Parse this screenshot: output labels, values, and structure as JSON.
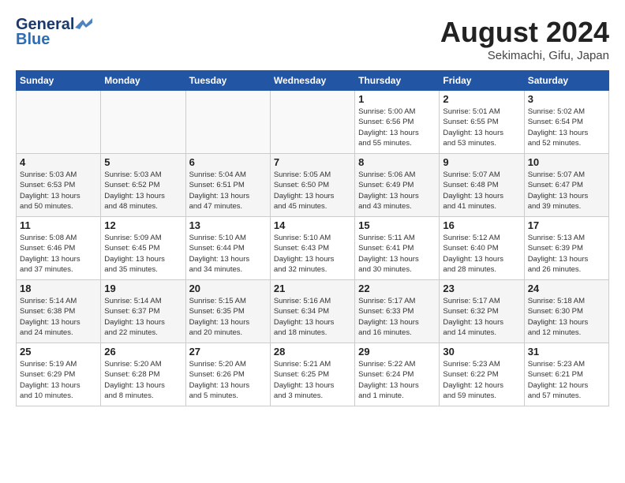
{
  "header": {
    "logo_general": "General",
    "logo_blue": "Blue",
    "month_title": "August 2024",
    "subtitle": "Sekimachi, Gifu, Japan"
  },
  "days_of_week": [
    "Sunday",
    "Monday",
    "Tuesday",
    "Wednesday",
    "Thursday",
    "Friday",
    "Saturday"
  ],
  "weeks": [
    [
      {
        "day": "",
        "text": ""
      },
      {
        "day": "",
        "text": ""
      },
      {
        "day": "",
        "text": ""
      },
      {
        "day": "",
        "text": ""
      },
      {
        "day": "1",
        "text": "Sunrise: 5:00 AM\nSunset: 6:56 PM\nDaylight: 13 hours\nand 55 minutes."
      },
      {
        "day": "2",
        "text": "Sunrise: 5:01 AM\nSunset: 6:55 PM\nDaylight: 13 hours\nand 53 minutes."
      },
      {
        "day": "3",
        "text": "Sunrise: 5:02 AM\nSunset: 6:54 PM\nDaylight: 13 hours\nand 52 minutes."
      }
    ],
    [
      {
        "day": "4",
        "text": "Sunrise: 5:03 AM\nSunset: 6:53 PM\nDaylight: 13 hours\nand 50 minutes."
      },
      {
        "day": "5",
        "text": "Sunrise: 5:03 AM\nSunset: 6:52 PM\nDaylight: 13 hours\nand 48 minutes."
      },
      {
        "day": "6",
        "text": "Sunrise: 5:04 AM\nSunset: 6:51 PM\nDaylight: 13 hours\nand 47 minutes."
      },
      {
        "day": "7",
        "text": "Sunrise: 5:05 AM\nSunset: 6:50 PM\nDaylight: 13 hours\nand 45 minutes."
      },
      {
        "day": "8",
        "text": "Sunrise: 5:06 AM\nSunset: 6:49 PM\nDaylight: 13 hours\nand 43 minutes."
      },
      {
        "day": "9",
        "text": "Sunrise: 5:07 AM\nSunset: 6:48 PM\nDaylight: 13 hours\nand 41 minutes."
      },
      {
        "day": "10",
        "text": "Sunrise: 5:07 AM\nSunset: 6:47 PM\nDaylight: 13 hours\nand 39 minutes."
      }
    ],
    [
      {
        "day": "11",
        "text": "Sunrise: 5:08 AM\nSunset: 6:46 PM\nDaylight: 13 hours\nand 37 minutes."
      },
      {
        "day": "12",
        "text": "Sunrise: 5:09 AM\nSunset: 6:45 PM\nDaylight: 13 hours\nand 35 minutes."
      },
      {
        "day": "13",
        "text": "Sunrise: 5:10 AM\nSunset: 6:44 PM\nDaylight: 13 hours\nand 34 minutes."
      },
      {
        "day": "14",
        "text": "Sunrise: 5:10 AM\nSunset: 6:43 PM\nDaylight: 13 hours\nand 32 minutes."
      },
      {
        "day": "15",
        "text": "Sunrise: 5:11 AM\nSunset: 6:41 PM\nDaylight: 13 hours\nand 30 minutes."
      },
      {
        "day": "16",
        "text": "Sunrise: 5:12 AM\nSunset: 6:40 PM\nDaylight: 13 hours\nand 28 minutes."
      },
      {
        "day": "17",
        "text": "Sunrise: 5:13 AM\nSunset: 6:39 PM\nDaylight: 13 hours\nand 26 minutes."
      }
    ],
    [
      {
        "day": "18",
        "text": "Sunrise: 5:14 AM\nSunset: 6:38 PM\nDaylight: 13 hours\nand 24 minutes."
      },
      {
        "day": "19",
        "text": "Sunrise: 5:14 AM\nSunset: 6:37 PM\nDaylight: 13 hours\nand 22 minutes."
      },
      {
        "day": "20",
        "text": "Sunrise: 5:15 AM\nSunset: 6:35 PM\nDaylight: 13 hours\nand 20 minutes."
      },
      {
        "day": "21",
        "text": "Sunrise: 5:16 AM\nSunset: 6:34 PM\nDaylight: 13 hours\nand 18 minutes."
      },
      {
        "day": "22",
        "text": "Sunrise: 5:17 AM\nSunset: 6:33 PM\nDaylight: 13 hours\nand 16 minutes."
      },
      {
        "day": "23",
        "text": "Sunrise: 5:17 AM\nSunset: 6:32 PM\nDaylight: 13 hours\nand 14 minutes."
      },
      {
        "day": "24",
        "text": "Sunrise: 5:18 AM\nSunset: 6:30 PM\nDaylight: 13 hours\nand 12 minutes."
      }
    ],
    [
      {
        "day": "25",
        "text": "Sunrise: 5:19 AM\nSunset: 6:29 PM\nDaylight: 13 hours\nand 10 minutes."
      },
      {
        "day": "26",
        "text": "Sunrise: 5:20 AM\nSunset: 6:28 PM\nDaylight: 13 hours\nand 8 minutes."
      },
      {
        "day": "27",
        "text": "Sunrise: 5:20 AM\nSunset: 6:26 PM\nDaylight: 13 hours\nand 5 minutes."
      },
      {
        "day": "28",
        "text": "Sunrise: 5:21 AM\nSunset: 6:25 PM\nDaylight: 13 hours\nand 3 minutes."
      },
      {
        "day": "29",
        "text": "Sunrise: 5:22 AM\nSunset: 6:24 PM\nDaylight: 13 hours\nand 1 minute."
      },
      {
        "day": "30",
        "text": "Sunrise: 5:23 AM\nSunset: 6:22 PM\nDaylight: 12 hours\nand 59 minutes."
      },
      {
        "day": "31",
        "text": "Sunrise: 5:23 AM\nSunset: 6:21 PM\nDaylight: 12 hours\nand 57 minutes."
      }
    ]
  ]
}
